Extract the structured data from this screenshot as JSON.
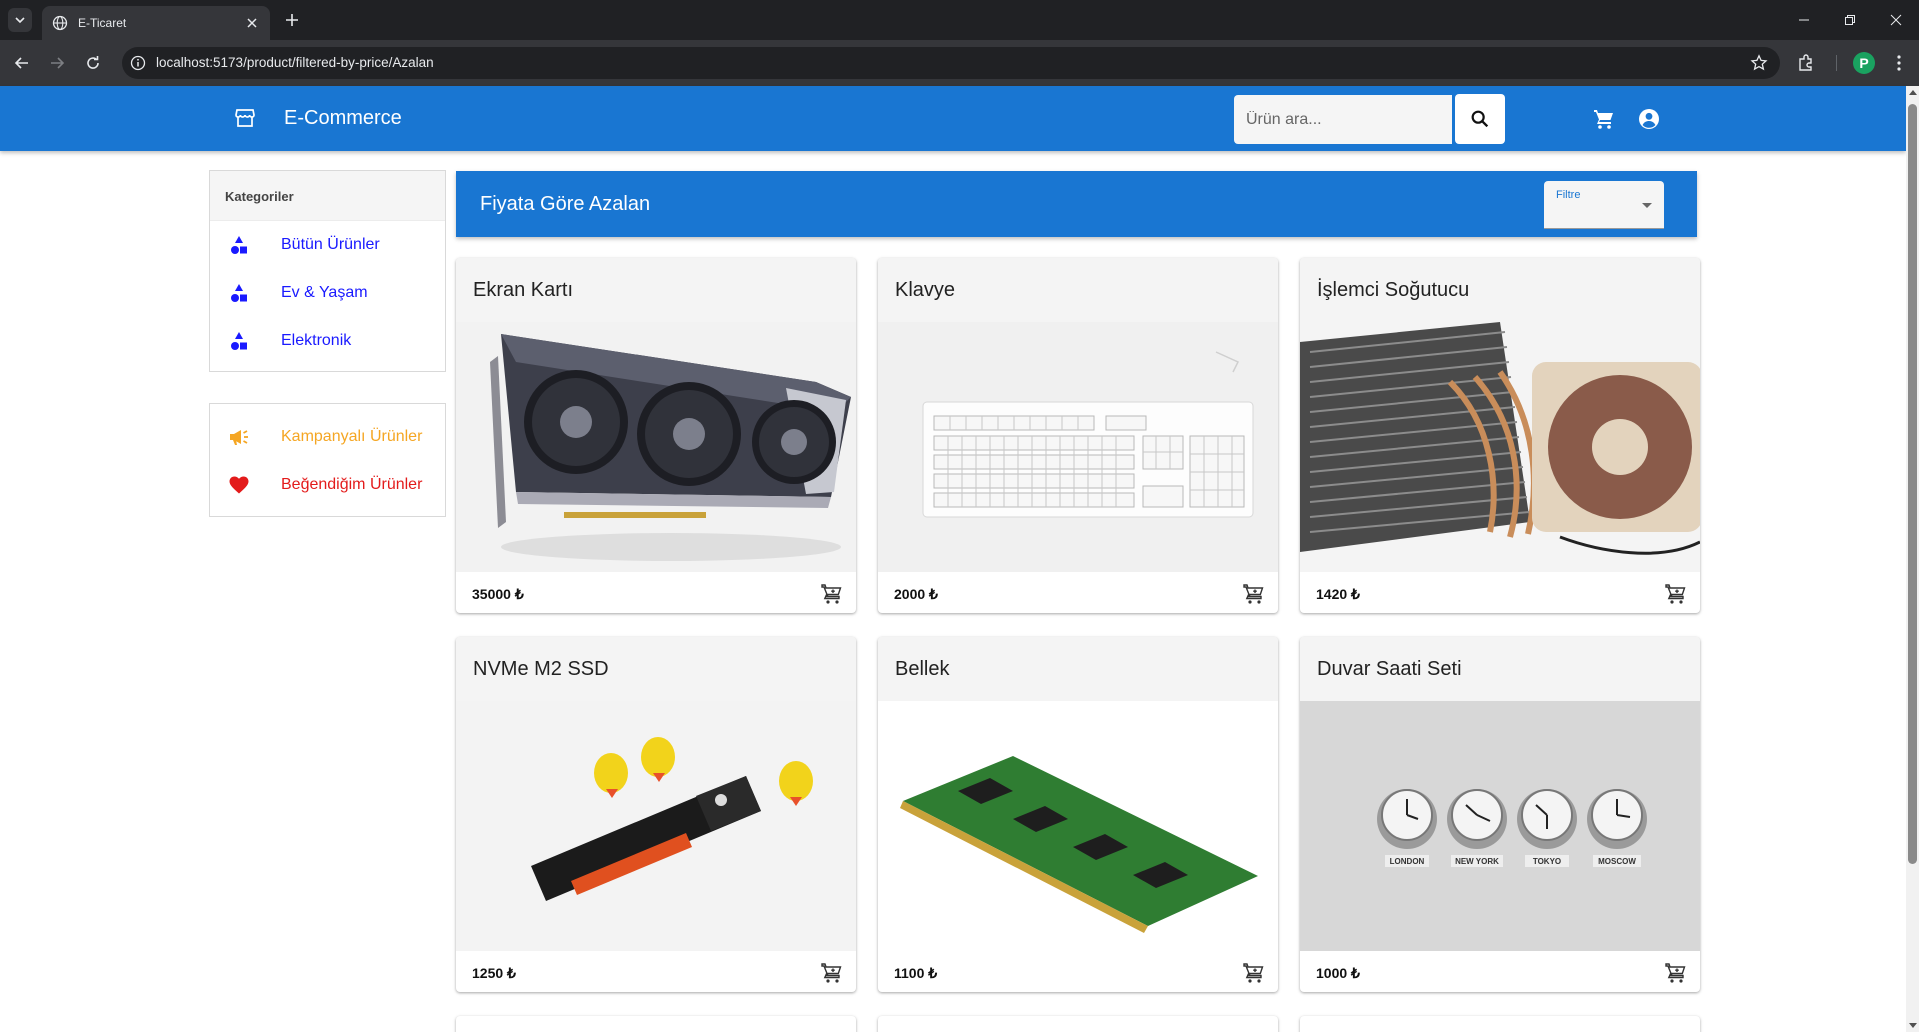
{
  "browser": {
    "tab_title": "E-Ticaret",
    "url": "localhost:5173/product/filtered-by-price/Azalan",
    "profile_initial": "P"
  },
  "header": {
    "title": "E-Commerce",
    "search_placeholder": "Ürün ara..."
  },
  "sidebar": {
    "categories_title": "Kategoriler",
    "categories": [
      {
        "label": "Bütün Ürünler",
        "icon": "category-icon"
      },
      {
        "label": "Ev & Yaşam",
        "icon": "category-icon"
      },
      {
        "label": "Elektronik",
        "icon": "category-icon"
      }
    ],
    "extras": [
      {
        "label": "Kampanyalı Ürünler",
        "icon": "campaign-icon",
        "color": "#f5a623"
      },
      {
        "label": "Beğendiğim Ürünler",
        "icon": "heart-icon",
        "color": "#e31b1b"
      }
    ]
  },
  "main": {
    "title": "Fiyata Göre Azalan",
    "filter_label": "Filtre",
    "products": [
      {
        "name": "Ekran Kartı",
        "price": "35000 ₺"
      },
      {
        "name": "Klavye",
        "price": "2000 ₺"
      },
      {
        "name": "İşlemci Soğutucu",
        "price": "1420 ₺"
      },
      {
        "name": "NVMe M2 SSD",
        "price": "1250 ₺"
      },
      {
        "name": "Bellek",
        "price": "1100 ₺"
      },
      {
        "name": "Duvar Saati Seti",
        "price": "1000 ₺"
      }
    ],
    "clock_cities": [
      "LONDON",
      "NEW YORK",
      "TOKYO",
      "MOSCOW"
    ]
  },
  "colors": {
    "primary": "#1976d2",
    "link_blue": "#1a1aff",
    "campaign": "#f5a623",
    "favorite": "#e31b1b"
  }
}
